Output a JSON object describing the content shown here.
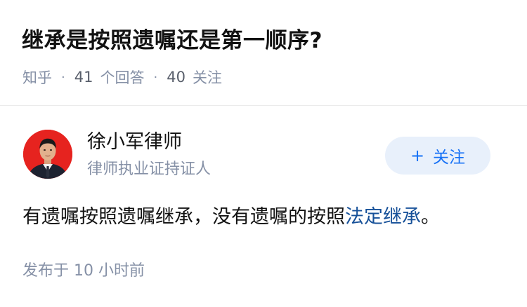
{
  "question": {
    "title": "继承是按照遗嘱还是第一顺序?",
    "source": "知乎",
    "answer_count": "41",
    "answer_label": "个回答",
    "follower_count": "40",
    "follower_label": "关注",
    "separator": "·"
  },
  "author": {
    "name": "徐小军律师",
    "badge": "律师执业证持证人",
    "follow_button": {
      "icon": "+",
      "label": "关注"
    }
  },
  "answer": {
    "text_before_link": "有遗嘱按照遗嘱继承，没有遗嘱的按照",
    "link_text": "法定继承",
    "text_after_link": "。"
  },
  "publish": {
    "label": "发布于",
    "time": "10 小时前"
  },
  "colors": {
    "accent_blue": "#1772f6",
    "link_blue": "#175199",
    "meta_gray": "#8590a6",
    "follow_bg": "#e8f0fb",
    "avatar_bg": "#e6231f"
  }
}
